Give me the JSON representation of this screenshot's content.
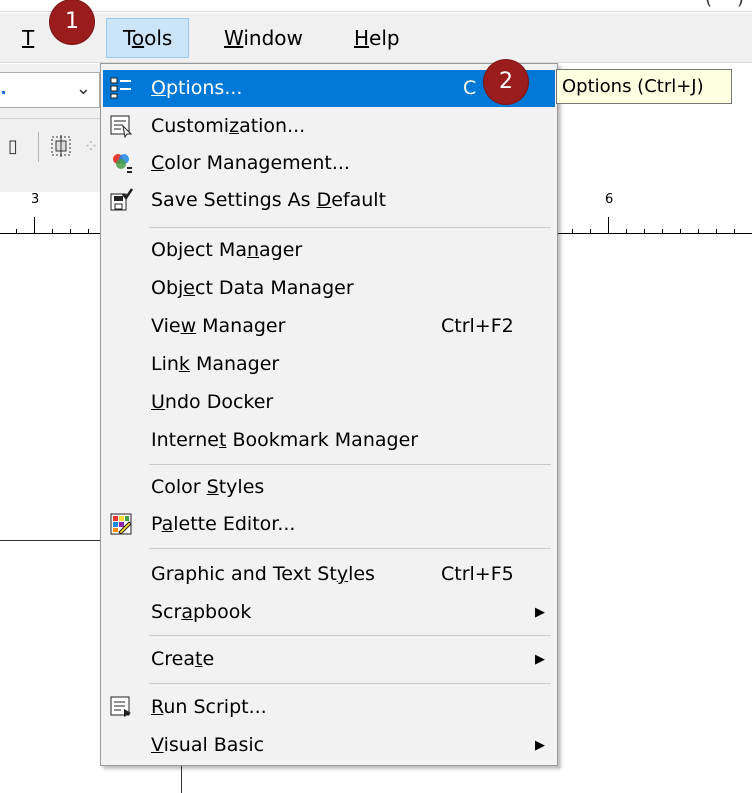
{
  "top_fragments": {
    "left": "(",
    "right": ")"
  },
  "menubar": {
    "partial_item": "T",
    "items": [
      {
        "label": "Tools",
        "underline": "o"
      },
      {
        "label": "Window",
        "underline": "W"
      },
      {
        "label": "Help",
        "underline": "H"
      }
    ]
  },
  "ruler": {
    "left_number": "3",
    "right_number": "6"
  },
  "menu": {
    "items": [
      {
        "label": "Options...",
        "shortcut": "C",
        "icon": "options-icon"
      },
      {
        "label": "Customization...",
        "icon": "customization-icon"
      },
      {
        "label": "Color Management...",
        "icon": "color-management-icon"
      },
      {
        "label": "Save Settings As Default",
        "icon": "save-settings-icon"
      },
      {
        "label": "Object Manager"
      },
      {
        "label": "Object Data Manager"
      },
      {
        "label": "View Manager",
        "shortcut": "Ctrl+F2"
      },
      {
        "label": "Link Manager"
      },
      {
        "label": "Undo Docker"
      },
      {
        "label": "Internet Bookmark Manager"
      },
      {
        "label": "Color Styles"
      },
      {
        "label": "Palette Editor...",
        "icon": "palette-editor-icon"
      },
      {
        "label": "Graphic and Text Styles",
        "shortcut": "Ctrl+F5"
      },
      {
        "label": "Scrapbook",
        "submenu": true
      },
      {
        "label": "Create",
        "submenu": true
      },
      {
        "label": "Run Script...",
        "icon": "run-script-icon"
      },
      {
        "label": "Visual Basic",
        "submenu": true
      }
    ]
  },
  "tooltip": "Options (Ctrl+J)",
  "callouts": [
    "1",
    "2"
  ],
  "colors": {
    "highlight": "#0078d7",
    "callout": "#9b1c1c",
    "tooltip_bg": "#ffffe1"
  }
}
